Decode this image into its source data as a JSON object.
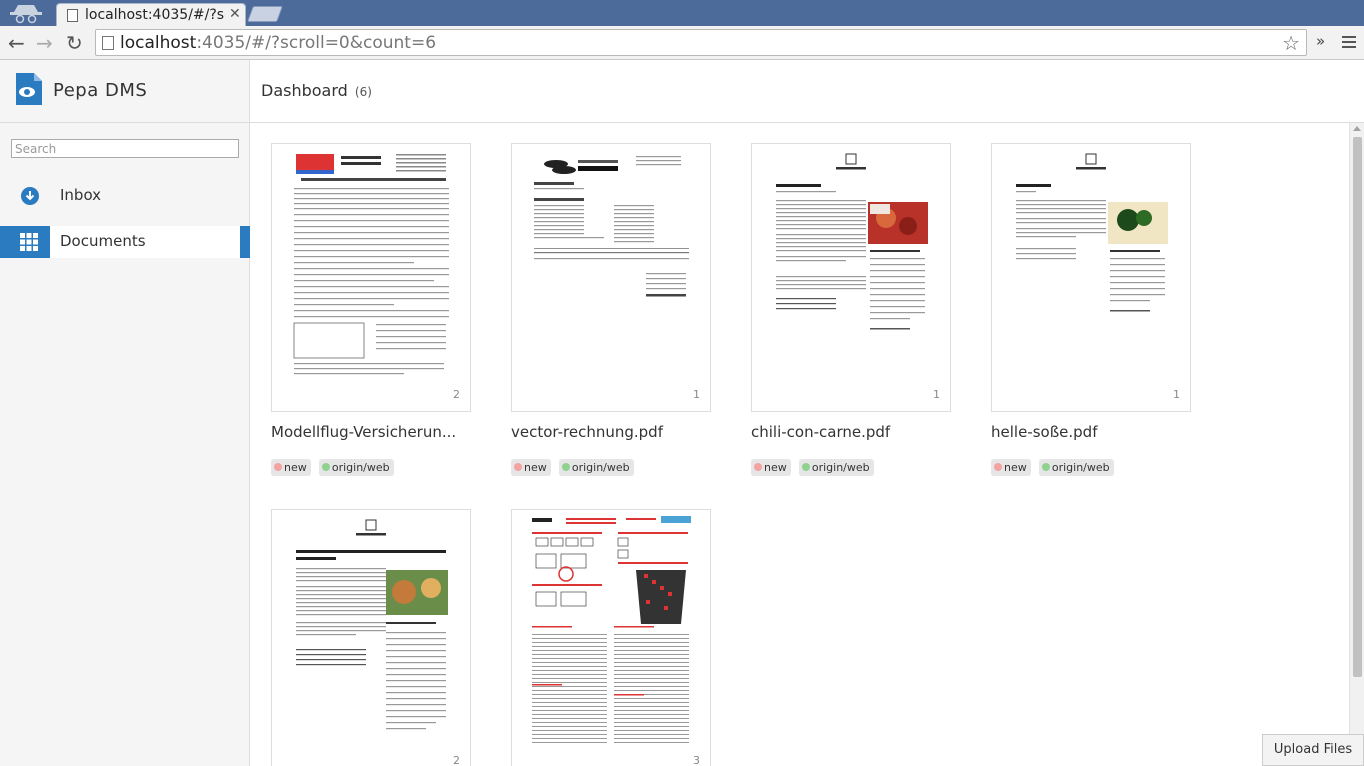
{
  "browser": {
    "tab_title": "localhost:4035/#/?scroll=0&count=6",
    "url_host": "localhost",
    "url_rest": ":4035/#/?scroll=0&count=6"
  },
  "sidebar": {
    "app_name": "Pepa DMS",
    "search_placeholder": "Search",
    "items": [
      {
        "label": "Inbox",
        "icon": "download-circle-icon"
      },
      {
        "label": "Documents",
        "icon": "grid-icon",
        "active": true
      }
    ]
  },
  "header": {
    "title": "Dashboard",
    "count": "(6)"
  },
  "documents": [
    {
      "name": "Modellflug-Versicherun...",
      "pages": "2",
      "tags": [
        {
          "label": "new",
          "color": "#f4a3a3"
        },
        {
          "label": "origin/web",
          "color": "#8fd18f"
        }
      ]
    },
    {
      "name": "vector-rechnung.pdf",
      "pages": "1",
      "tags": [
        {
          "label": "new",
          "color": "#f4a3a3"
        },
        {
          "label": "origin/web",
          "color": "#8fd18f"
        }
      ]
    },
    {
      "name": "chili-con-carne.pdf",
      "pages": "1",
      "tags": [
        {
          "label": "new",
          "color": "#f4a3a3"
        },
        {
          "label": "origin/web",
          "color": "#8fd18f"
        }
      ]
    },
    {
      "name": "helle-soße.pdf",
      "pages": "1",
      "tags": [
        {
          "label": "new",
          "color": "#f4a3a3"
        },
        {
          "label": "origin/web",
          "color": "#8fd18f"
        }
      ]
    },
    {
      "name": "",
      "pages": "2",
      "tags": []
    },
    {
      "name": "",
      "pages": "3",
      "tags": []
    }
  ],
  "upload_label": "Upload Files",
  "colors": {
    "accent": "#2a7bbf",
    "tag_new": "#f4a3a3",
    "tag_origin": "#8fd18f"
  }
}
